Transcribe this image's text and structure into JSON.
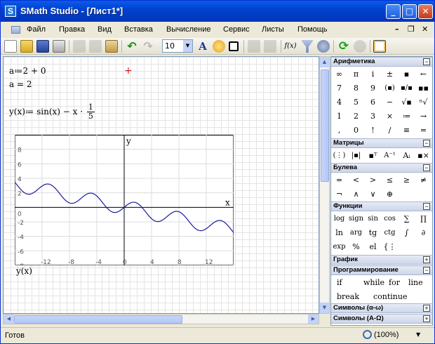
{
  "window": {
    "title": "SMath Studio - [Лист1*]",
    "app_icon": "S"
  },
  "menu": [
    "Файл",
    "Правка",
    "Вид",
    "Вставка",
    "Вычисление",
    "Сервис",
    "Листы",
    "Помощь"
  ],
  "mdi_controls": [
    "–",
    "❐",
    "✕"
  ],
  "toolbar": {
    "font_size": "10"
  },
  "worksheet": {
    "lines": [
      {
        "text": "a:=2+0",
        "display": "a≔2 + 0"
      },
      {
        "text": "a=2",
        "display": "a = 2"
      }
    ],
    "func_def": {
      "lhs": "y(x)≔ sin(x) − x ·",
      "num": "1",
      "den": "5"
    },
    "plot_label": "y(x)",
    "cursor": "+"
  },
  "chart_data": {
    "type": "line",
    "xlabel": "x",
    "ylabel": "y",
    "xlim": [
      -16,
      16
    ],
    "ylim": [
      -8,
      10
    ],
    "x_ticks": [
      -12,
      -8,
      -4,
      0,
      4,
      8,
      12
    ],
    "y_ticks": [
      8,
      6,
      4,
      2,
      0,
      -2,
      -4,
      -6,
      -8
    ],
    "function": "sin(x) - x/5",
    "series": [
      {
        "name": "y(x)",
        "color": "#1a1aa0"
      }
    ]
  },
  "panel": {
    "sections": [
      {
        "title": "Арифметика",
        "toggle": "⊟",
        "rows": [
          [
            "∞",
            "π",
            "i",
            "±",
            "▪",
            "←"
          ],
          [
            "7",
            "8",
            "9",
            "(▪)",
            "▪/▪",
            "▪▪"
          ],
          [
            "4",
            "5",
            "6",
            "−",
            "√▪",
            "ⁿ√"
          ],
          [
            "1",
            "2",
            "3",
            "×",
            "≔",
            "→"
          ],
          [
            ",",
            "0",
            "!",
            "/",
            "≡",
            "="
          ]
        ]
      },
      {
        "title": "Матрицы",
        "toggle": "⊟",
        "rows": [
          [
            "(⋮)",
            "|▪|",
            "▪ᵀ",
            "A⁻¹",
            "Aᵢ",
            "▪×"
          ]
        ]
      },
      {
        "title": "Булева",
        "toggle": "⊟",
        "rows": [
          [
            "=",
            "<",
            ">",
            "≤",
            "≥",
            "≠"
          ],
          [
            "¬",
            "∧",
            "∨",
            "⊕"
          ]
        ]
      },
      {
        "title": "Функции",
        "toggle": "⊟",
        "rows": [
          [
            "log",
            "sign",
            "sin",
            "cos",
            "∑",
            "∏"
          ],
          [
            "ln",
            "arg",
            "tg",
            "ctg",
            "∫",
            "∂"
          ],
          [
            "exp",
            "%",
            "el",
            "{⋮"
          ]
        ]
      },
      {
        "title": "График",
        "toggle": "⊞"
      },
      {
        "title": "Программирование",
        "toggle": "⊟",
        "rows": [
          [
            "if",
            "while",
            "for",
            "line"
          ],
          [
            "break",
            "continue"
          ]
        ]
      },
      {
        "title": "Символы (α-ω)",
        "toggle": "⊞"
      },
      {
        "title": "Символы (А-Ω)",
        "toggle": "⊞"
      }
    ]
  },
  "status": {
    "text": "Готов",
    "zoom": "(100%)"
  }
}
